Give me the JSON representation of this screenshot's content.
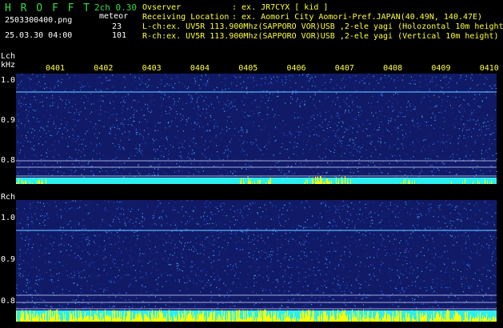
{
  "header": {
    "app_title": "H R O F F T",
    "mode": "2ch 0.30",
    "filename": "2503300400.png",
    "meteor_label": "meteor",
    "meteor_counts": [
      "23",
      "101"
    ],
    "datetime": "25.03.30 04:00",
    "observer_label": "Ovserver",
    "observer_value": ": ex. JR7CYX [ kid ]",
    "location_label": "Receiving Location",
    "location_value": ": ex. Aomori City Aomori-Pref.JAPAN(40.49N, 140.47E)",
    "lch_line": "L-ch:ex. UV5R 113.900Mhz(SAPPORO VOR)USB ,2-ele yagi (Holozontal 10m height)",
    "rch_line": "R-ch:ex. UV5R 113.900Mhz(SAPPORO VOR)USB ,2-ele yagi (Vertical 10m height)"
  },
  "left_channel": {
    "label": "Lch",
    "unit": "kHz",
    "y_ticks": [
      "1.0",
      "0.9",
      "0.8"
    ]
  },
  "right_channel": {
    "label": "Rch",
    "y_ticks": [
      "1.0",
      "0.9",
      "0.8"
    ]
  },
  "time_ticks": [
    "0401",
    "0402",
    "0403",
    "0404",
    "0405",
    "0406",
    "0407",
    "0408",
    "0409",
    "0410"
  ],
  "colors": {
    "header_green": "#39d84a",
    "header_white": "#ffffff",
    "tick_yellow": "#ffff3a",
    "spectrogram_bg": "#101a66",
    "signal_cyan": "#2cf0f0",
    "signal_yellow": "#ffff00"
  }
}
